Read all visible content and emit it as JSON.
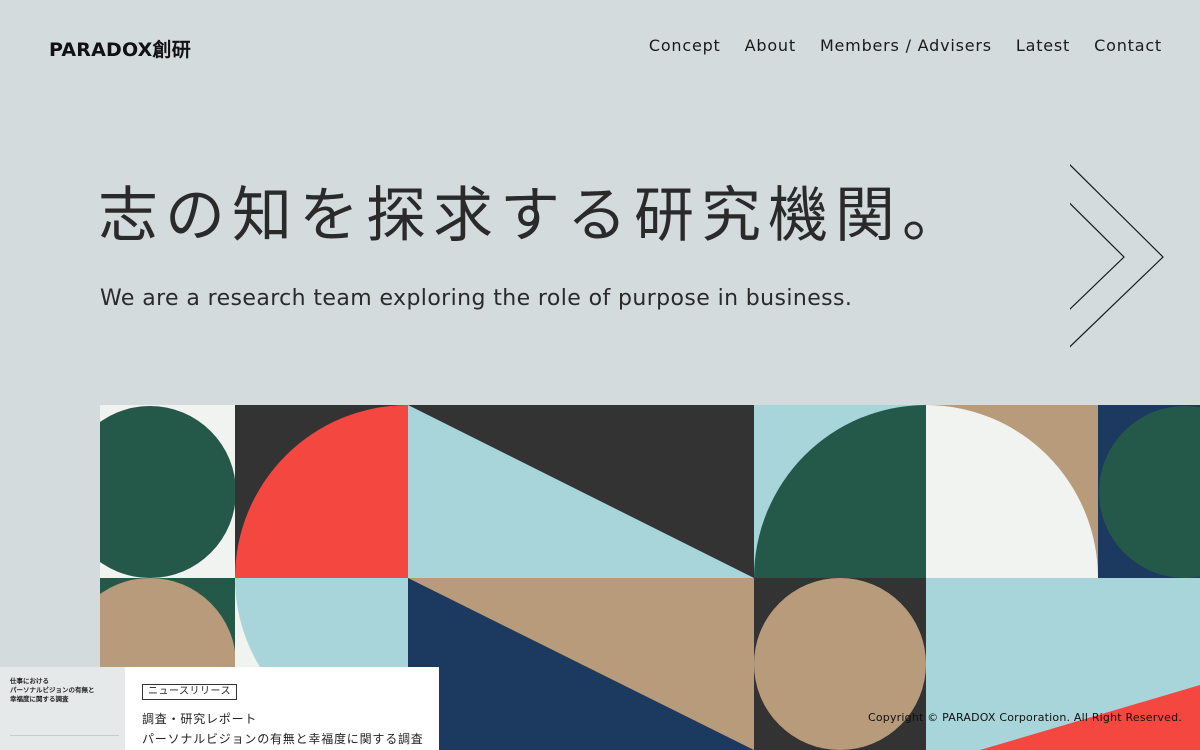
{
  "header": {
    "logo": "PARADOX創研",
    "nav": [
      {
        "label": "Concept"
      },
      {
        "label": "About"
      },
      {
        "label": "Members / Advisers"
      },
      {
        "label": "Latest"
      },
      {
        "label": "Contact"
      }
    ]
  },
  "hero": {
    "title": "志の知を探求する研究機関。",
    "subtitle": "We are a research team exploring the role of purpose in business."
  },
  "colors": {
    "background": "#d3dbdc",
    "dark_green": "#24594a",
    "coral": "#f4473f",
    "light_blue": "#a8d5da",
    "charcoal": "#333333",
    "tan": "#b89b7a",
    "navy": "#1c3a5f",
    "off_white": "#f1f3f1"
  },
  "news": {
    "thumb_lines": [
      "仕事における",
      "パーソナルビジョンの有無と",
      "幸福度に関する調査"
    ],
    "badge": "ニュースリリース",
    "line1": "調査・研究レポート",
    "line2": "パーソナルビジョンの有無と幸福度に関する調査"
  },
  "footer": {
    "copyright": "Copyright © PARADOX Corporation. All Right Reserved."
  }
}
